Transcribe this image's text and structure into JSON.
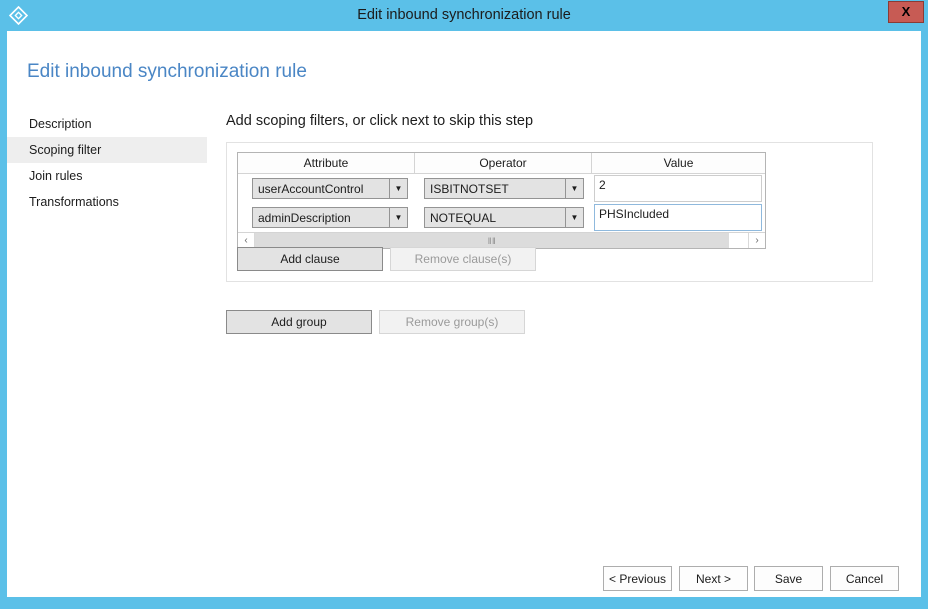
{
  "window": {
    "title": "Edit inbound synchronization rule",
    "app_icon": "azure-ad-connect-diamond-icon",
    "close_label": "X",
    "border_color": "#5bc0e8",
    "close_button_color": "#c75b54"
  },
  "page": {
    "heading": "Edit inbound synchronization rule",
    "heading_color": "#4a86c5"
  },
  "sidebar": {
    "items": [
      {
        "label": "Description",
        "selected": false
      },
      {
        "label": "Scoping filter",
        "selected": true
      },
      {
        "label": "Join rules",
        "selected": false
      },
      {
        "label": "Transformations",
        "selected": false
      }
    ]
  },
  "main": {
    "content_title": "Add scoping filters, or click next to skip this step",
    "grid": {
      "columns": [
        "Attribute",
        "Operator",
        "Value"
      ],
      "rows": [
        {
          "attribute": "userAccountControl",
          "operator": "ISBITNOTSET",
          "value": "2",
          "value_focused": false
        },
        {
          "attribute": "adminDescription",
          "operator": "NOTEQUAL",
          "value": "PHSIncluded",
          "value_focused": true
        }
      ],
      "scrollbar": {
        "left_arrow": "‹",
        "right_arrow": "›",
        "grip": "‖‖"
      }
    },
    "clause_buttons": {
      "add": "Add clause",
      "remove": "Remove clause(s)",
      "remove_disabled": true
    },
    "group_buttons": {
      "add": "Add group",
      "remove": "Remove group(s)",
      "remove_disabled": true
    }
  },
  "footer": {
    "previous": "< Previous",
    "next": "Next >",
    "save": "Save",
    "cancel": "Cancel"
  }
}
